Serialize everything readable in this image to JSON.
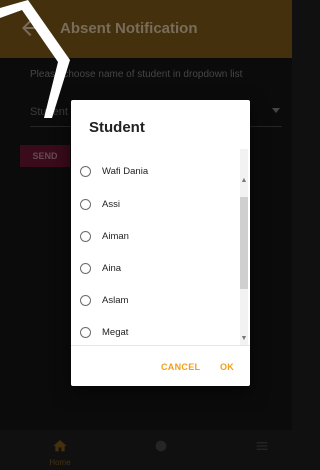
{
  "appbar": {
    "title": "Absent Notification",
    "back_icon": "arrow-back-icon"
  },
  "form": {
    "instruction": "Please choose name of student in dropdown list",
    "student_label": "Student",
    "send_label": "SEND"
  },
  "dialog": {
    "title": "Student",
    "options": [
      {
        "label": "Wafi Dania"
      },
      {
        "label": "Assi"
      },
      {
        "label": "Aiman"
      },
      {
        "label": "Aina"
      },
      {
        "label": "Aslam"
      },
      {
        "label": "Megat"
      }
    ],
    "cancel_label": "CANCEL",
    "ok_label": "OK"
  },
  "bottom_nav": {
    "items": [
      {
        "label": "Home",
        "icon": "home-icon"
      },
      {
        "label": "",
        "icon": "circle-icon"
      },
      {
        "label": "",
        "icon": "list-icon"
      }
    ]
  },
  "colors": {
    "appbar": "#6a4a16",
    "accent": "#f0a017",
    "send_button": "#5a1228",
    "background": "#121212"
  }
}
